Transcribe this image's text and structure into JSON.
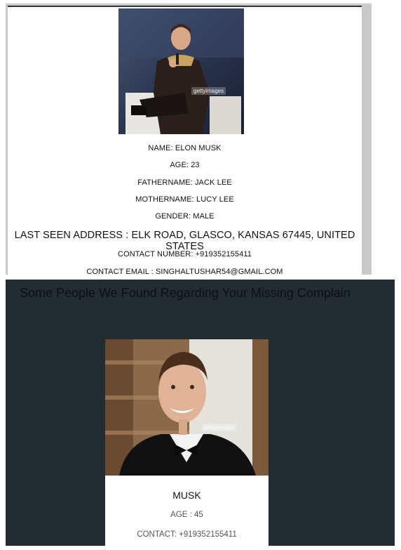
{
  "profile": {
    "photo_label": "gettyimages",
    "name": "NAME: ELON MUSK",
    "age": "AGE: 23",
    "fathername": "FATHERNAME: JACK LEE",
    "mothername": "MOTHERNAME: LUCY LEE",
    "gender": "GENDER: MALE",
    "last_seen_address": "LAST SEEN ADDRESS : ELK ROAD, GLASCO, KANSAS 67445, UNITED STATES",
    "contact_number": "CONTACT NUMBER: +919352155411",
    "contact_email": "CONTACT EMAIL : SINGHALTUSHAR54@GMAIL.COM"
  },
  "matches": {
    "title": "Some People We Found Regarding Your Missing Complain",
    "cards": [
      {
        "photo_label": "gettyimages",
        "name": "MUSK",
        "age": "AGE : 45",
        "contact": "CONTACT: +919352155411"
      }
    ]
  }
}
